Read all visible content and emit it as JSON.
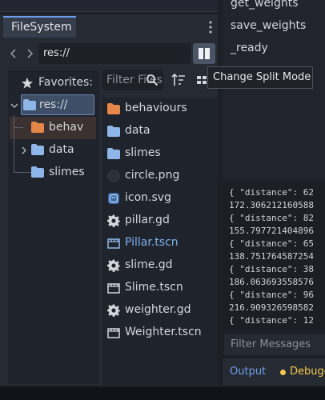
{
  "colors": {
    "accent": "#699ce8",
    "folder_blue": "#8eb6e8",
    "folder_orange": "#e6874a",
    "debugger_yellow": "#f2c94c"
  },
  "dock": {
    "tab_label": "FileSystem",
    "path": "res://",
    "filter_placeholder": "Filter Files",
    "tooltip": "Change Split Mode"
  },
  "tree": {
    "favorites": "Favorites:",
    "root": "res://",
    "items": [
      {
        "label": "behav",
        "icon": "folder-orange-icon"
      },
      {
        "label": "data",
        "icon": "folder-icon"
      },
      {
        "label": "slimes",
        "icon": "folder-icon"
      }
    ]
  },
  "files": [
    {
      "label": "behaviours",
      "icon": "folder-orange-icon",
      "active": false
    },
    {
      "label": "data",
      "icon": "folder-icon",
      "active": false
    },
    {
      "label": "slimes",
      "icon": "folder-icon",
      "active": false
    },
    {
      "label": "circle.png",
      "icon": "image-icon",
      "active": false
    },
    {
      "label": "icon.svg",
      "icon": "svg-icon",
      "active": false
    },
    {
      "label": "pillar.gd",
      "icon": "gear-icon",
      "active": false
    },
    {
      "label": "Pillar.tscn",
      "icon": "scene-icon",
      "active": true
    },
    {
      "label": "slime.gd",
      "icon": "gear-icon",
      "active": false
    },
    {
      "label": "Slime.tscn",
      "icon": "scene-icon",
      "active": false
    },
    {
      "label": "weighter.gd",
      "icon": "gear-icon",
      "active": false
    },
    {
      "label": "Weighter.tscn",
      "icon": "scene-icon",
      "active": false
    }
  ],
  "methods": [
    "get_weights",
    "save_weights",
    "_ready"
  ],
  "output": {
    "lines": [
      "{ \"distance\": 62",
      "172.306212160588",
      "{ \"distance\": 82",
      "155.797721404896",
      "{ \"distance\": 65",
      "138.751764587254",
      "{ \"distance\": 38",
      "186.063693558576",
      "{ \"distance\": 96",
      "216.909326598582",
      "{ \"distance\": 12"
    ],
    "filter_placeholder": "Filter Messages",
    "tab_output": "Output",
    "tab_debugger": "Debugger"
  }
}
